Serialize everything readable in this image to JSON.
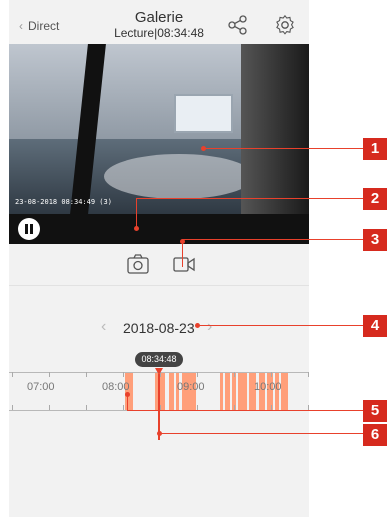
{
  "header": {
    "back_label": "Direct",
    "title": "Galerie",
    "subtitle": "Lecture|08:34:48",
    "icons": [
      "share-icon",
      "gear-icon"
    ]
  },
  "video": {
    "timestamp_overlay": "23-08-2018 08:34:49 (3)"
  },
  "controls": {
    "icons": [
      "pause-icon",
      "camera-icon",
      "video-record-icon"
    ]
  },
  "date_nav": {
    "prev": "‹",
    "date": "2018-08-23",
    "next": "›"
  },
  "timeline": {
    "current_time": "08:34:48",
    "hours": [
      "07:00",
      "08:00",
      "09:00",
      "10:00"
    ]
  },
  "callouts": [
    "1",
    "2",
    "3",
    "4",
    "5",
    "6"
  ],
  "colors": {
    "accent_red": "#d62a1e",
    "recording_orange": "#ff9f7a",
    "cursor_red": "#e8412c"
  }
}
